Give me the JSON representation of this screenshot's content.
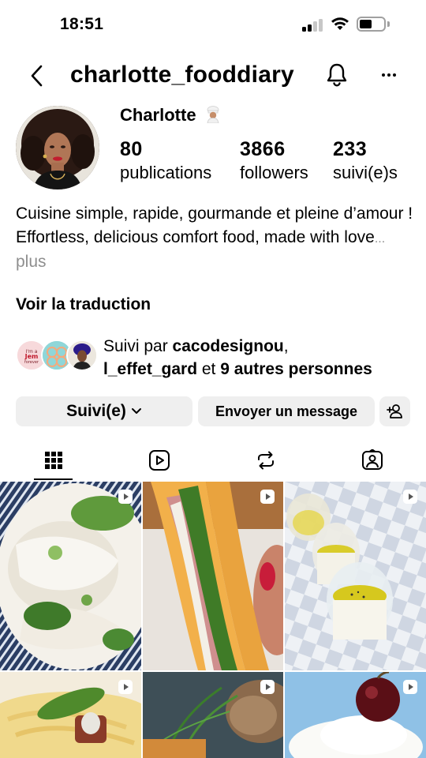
{
  "status_bar": {
    "time": "18:51"
  },
  "header": {
    "username": "charlotte_fooddiary"
  },
  "profile": {
    "display_name": "Charlotte",
    "stats": [
      {
        "value": "80",
        "label": "publications"
      },
      {
        "value": "3866",
        "label": "followers"
      },
      {
        "value": "233",
        "label": "suivi(e)s"
      }
    ],
    "bio": {
      "line1": "Cuisine simple, rapide, gourmande et pleine d’amour !",
      "line2": "Effortless, delicious comfort food, made with love",
      "ellipsis": "...",
      "more": "plus"
    },
    "translate": "Voir la traduction"
  },
  "followed_by": {
    "prefix": "Suivi par ",
    "user1": "cacodesignou",
    "sep": ",",
    "user2": "l_effet_gard",
    "mid": " et ",
    "others": "9 autres personnes",
    "avatar1_text": "I'm a Jem forever"
  },
  "buttons": {
    "following": "Suivi(e)",
    "message": "Envoyer un message"
  },
  "tabs": [
    "grid",
    "reels",
    "reposts",
    "tagged"
  ],
  "colors": {
    "muted": "#8e8e8e",
    "button_bg": "#efefef",
    "reel_badge": "#ffffff"
  }
}
